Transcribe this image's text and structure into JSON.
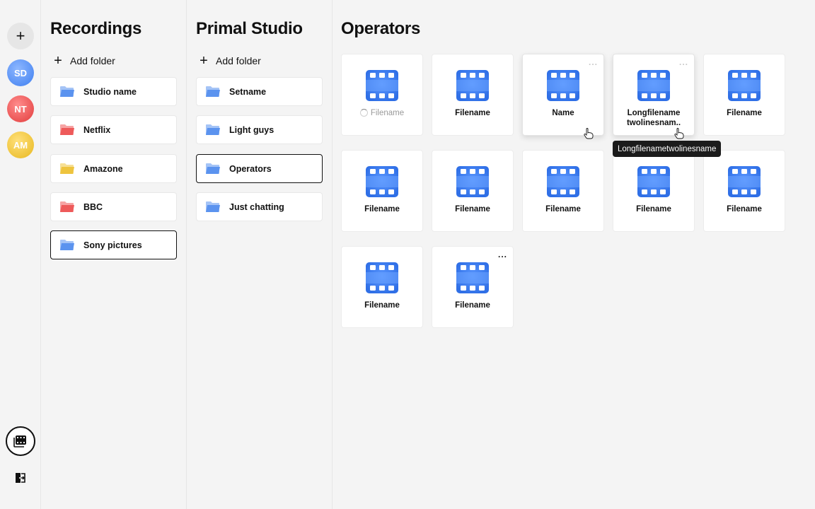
{
  "rail": {
    "add_label": "+",
    "avatars": [
      {
        "initials": "SD",
        "color": "#4f8cf2"
      },
      {
        "initials": "NT",
        "color": "#e64545"
      },
      {
        "initials": "AM",
        "color": "#ecc23a"
      }
    ]
  },
  "recordings": {
    "title": "Recordings",
    "add_folder": "Add folder",
    "items": [
      {
        "label": "Studio name",
        "color": "#5b93ef"
      },
      {
        "label": "Netflix",
        "color": "#ee5a5a"
      },
      {
        "label": "Amazone",
        "color": "#eec43e"
      },
      {
        "label": "BBC",
        "color": "#ee5a5a"
      },
      {
        "label": "Sony pictures",
        "color": "#5b93ef"
      }
    ]
  },
  "studio": {
    "title": "Primal Studio",
    "add_folder": "Add folder",
    "items": [
      {
        "label": "Setname"
      },
      {
        "label": "Light guys"
      },
      {
        "label": "Operators"
      },
      {
        "label": "Just chatting"
      }
    ]
  },
  "main": {
    "title": "Operators",
    "tiles": [
      {
        "name": "Filename",
        "loading": true
      },
      {
        "name": "Filename"
      },
      {
        "name": "Name",
        "menu": "..."
      },
      {
        "name": "Longfilename twolinesnam..",
        "menu": "..."
      },
      {
        "name": "Filename"
      },
      {
        "name": "Filename"
      },
      {
        "name": "Filename"
      },
      {
        "name": "Filename"
      },
      {
        "name": "Filename"
      },
      {
        "name": "Filename"
      },
      {
        "name": "Filename"
      },
      {
        "name": "Filename",
        "menu": "..."
      }
    ],
    "tooltip": "Longfilenametwolinesname"
  },
  "colors": {
    "accent": "#3f7ff0",
    "background": "#f4f4f4"
  }
}
